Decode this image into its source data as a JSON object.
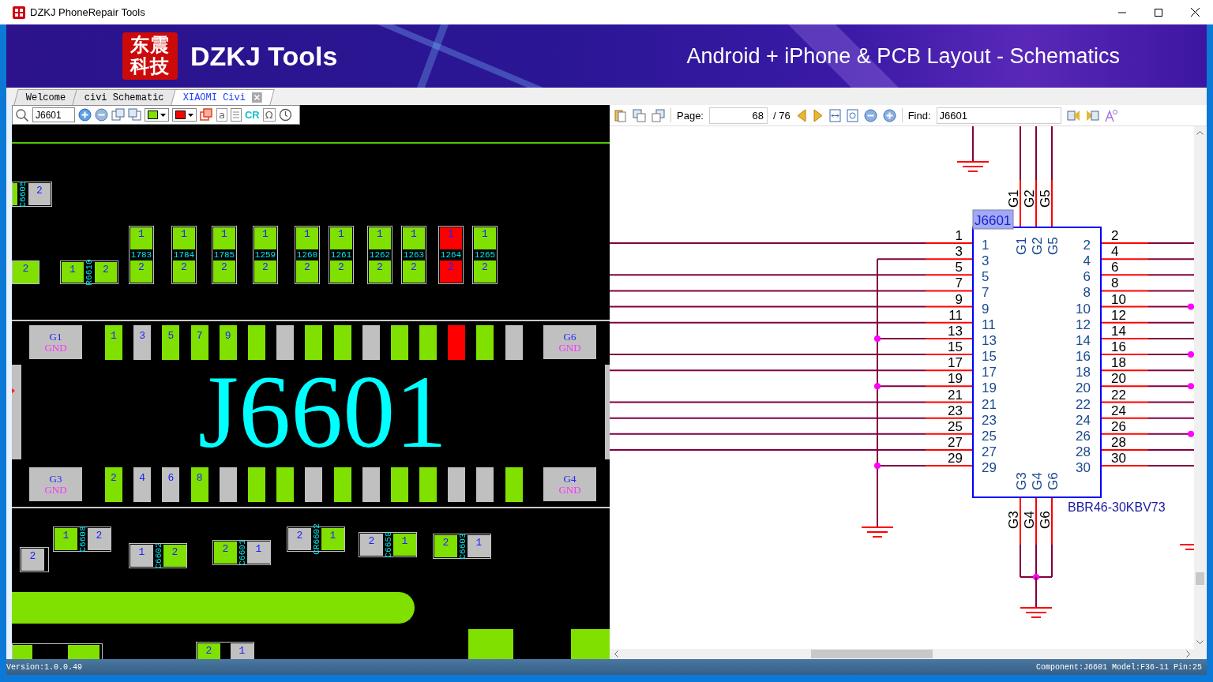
{
  "window": {
    "title": "DZKJ PhoneRepair Tools"
  },
  "banner": {
    "logo_lines": [
      "东震",
      "科技"
    ],
    "brand": "DZKJ Tools",
    "tagline": "Android + iPhone & PCB Layout - Schematics"
  },
  "tabs": [
    {
      "label": "Welcome",
      "selected": false,
      "closable": false
    },
    {
      "label": "civi Schematic",
      "selected": false,
      "closable": false
    },
    {
      "label": "XIAOMI Civi",
      "selected": true,
      "closable": true
    }
  ],
  "pcb_toolbar": {
    "search": "J6601",
    "color_pickers": [
      {
        "color": "#80e000"
      },
      {
        "color": "#ff0000"
      }
    ],
    "letter_button": "a",
    "cr_button": "CR",
    "omega_button": "Ω"
  },
  "pcb": {
    "corner_part": {
      "label": "C6605",
      "pad": "2"
    },
    "left_pads": [
      {
        "label": "2"
      }
    ],
    "resistor": {
      "label": "R6610",
      "pads": [
        "1",
        "2"
      ]
    },
    "vertical_parts": [
      {
        "label": "1783",
        "pad_1": "1",
        "pad_2": "2",
        "color": "#80e000"
      },
      {
        "label": "1784",
        "pad_1": "1",
        "pad_2": "2",
        "color": "#80e000"
      },
      {
        "label": "1785",
        "pad_1": "1",
        "pad_2": "2",
        "color": "#80e000"
      },
      {
        "label": "1259",
        "pad_1": "1",
        "pad_2": "2",
        "color": "#80e000"
      },
      {
        "label": "1260",
        "pad_1": "1",
        "pad_2": "2",
        "color": "#80e000"
      },
      {
        "label": "1261",
        "pad_1": "1",
        "pad_2": "2",
        "color": "#80e000"
      },
      {
        "label": "1262",
        "pad_1": "1",
        "pad_2": "2",
        "color": "#80e000"
      },
      {
        "label": "1263",
        "pad_1": "1",
        "pad_2": "2",
        "color": "#80e000"
      },
      {
        "label": "1264",
        "pad_1": "1",
        "pad_2": "2",
        "color": "#ff0000"
      },
      {
        "label": "1265",
        "pad_1": "1",
        "pad_2": "2",
        "color": "#80e000"
      }
    ],
    "connector": {
      "designator": "J6601",
      "ground_pads": [
        {
          "name": "G1",
          "net": "GND"
        },
        {
          "name": "G6",
          "net": "GND"
        },
        {
          "name": "G3",
          "net": "GND"
        },
        {
          "name": "G4",
          "net": "GND"
        }
      ],
      "top_pins": [
        {
          "label": "1",
          "color": "#80e000"
        },
        {
          "label": "3",
          "color": "#c0c0c0"
        },
        {
          "label": "5",
          "color": "#80e000"
        },
        {
          "label": "7",
          "color": "#80e000"
        },
        {
          "label": "9",
          "color": "#80e000"
        },
        {
          "color": "#80e000"
        },
        {
          "color": "#c0c0c0"
        },
        {
          "color": "#80e000"
        },
        {
          "color": "#80e000"
        },
        {
          "color": "#c0c0c0"
        },
        {
          "color": "#80e000"
        },
        {
          "color": "#80e000"
        },
        {
          "color": "#ff0000"
        },
        {
          "color": "#80e000"
        },
        {
          "color": "#c0c0c0"
        }
      ],
      "bottom_pins": [
        {
          "label": "2",
          "color": "#80e000"
        },
        {
          "label": "4",
          "color": "#c0c0c0"
        },
        {
          "label": "6",
          "color": "#c0c0c0"
        },
        {
          "label": "8",
          "color": "#80e000"
        },
        {
          "color": "#c0c0c0"
        },
        {
          "color": "#80e000"
        },
        {
          "color": "#80e000"
        },
        {
          "color": "#c0c0c0"
        },
        {
          "color": "#80e000"
        },
        {
          "color": "#c0c0c0"
        },
        {
          "color": "#80e000"
        },
        {
          "color": "#80e000"
        },
        {
          "color": "#c0c0c0"
        },
        {
          "color": "#c0c0c0"
        },
        {
          "color": "#80e000"
        }
      ]
    },
    "lower_parts": [
      {
        "pads": [
          {
            "label": "2",
            "color": "#c0c0c0"
          }
        ]
      },
      {
        "label": "C6608",
        "pads": [
          {
            "label": "1",
            "color": "#80e000"
          },
          {
            "label": "2",
            "color": "#c0c0c0"
          }
        ]
      },
      {
        "label": "C6602",
        "pads": [
          {
            "label": "1",
            "color": "#c0c0c0"
          },
          {
            "label": "2",
            "color": "#80e000"
          }
        ]
      },
      {
        "label": "C6601",
        "pads": [
          {
            "label": "2",
            "color": "#80e000"
          },
          {
            "label": "1",
            "color": "#c0c0c0"
          }
        ]
      },
      {
        "label": "CR6602",
        "pads": [
          {
            "label": "2",
            "color": "#c0c0c0"
          },
          {
            "label": "1",
            "color": "#80e000"
          }
        ]
      },
      {
        "label": "C6658",
        "pads": [
          {
            "label": "2",
            "color": "#c0c0c0"
          },
          {
            "label": "1",
            "color": "#80e000"
          }
        ]
      },
      {
        "label": "C6603",
        "pads": [
          {
            "label": "2",
            "color": "#80e000"
          },
          {
            "label": "1",
            "color": "#c0c0c0"
          }
        ]
      },
      {
        "pads": [
          {
            "label": "2",
            "color": "#80e000"
          },
          {
            "label": "1",
            "color": "#c0c0c0"
          }
        ]
      }
    ]
  },
  "viewer_toolbar": {
    "page_label": "Page:",
    "page": "68",
    "page_total": "/ 76",
    "find_label": "Find:",
    "find": "J6601"
  },
  "schematic": {
    "designator": "J6601",
    "part_number": "BBR46-30KBV73",
    "top_pins": [
      {
        "number": "G1",
        "name": "G1"
      },
      {
        "number": "G2",
        "name": "G2"
      },
      {
        "number": "G5",
        "name": "G5"
      }
    ],
    "bottom_pins": [
      {
        "number": "G3",
        "name": "G3"
      },
      {
        "number": "G4",
        "name": "G4"
      },
      {
        "number": "G6",
        "name": "G6"
      }
    ],
    "left_pins": [
      {
        "number": "1",
        "name": "1",
        "kind": "wire",
        "junction": false
      },
      {
        "number": "3",
        "name": "3",
        "kind": "bus",
        "junction": false
      },
      {
        "number": "5",
        "name": "5",
        "kind": "wire",
        "junction": false
      },
      {
        "number": "7",
        "name": "7",
        "kind": "wire",
        "junction": false
      },
      {
        "number": "9",
        "name": "9",
        "kind": "wire",
        "junction": false
      },
      {
        "number": "11",
        "name": "11",
        "kind": "wire",
        "junction": false
      },
      {
        "number": "13",
        "name": "13",
        "kind": "bus",
        "junction": true
      },
      {
        "number": "15",
        "name": "15",
        "kind": "wire",
        "junction": false
      },
      {
        "number": "17",
        "name": "17",
        "kind": "wire",
        "junction": false
      },
      {
        "number": "19",
        "name": "19",
        "kind": "bus",
        "junction": true
      },
      {
        "number": "21",
        "name": "21",
        "kind": "wire",
        "junction": false
      },
      {
        "number": "23",
        "name": "23",
        "kind": "wire",
        "junction": false
      },
      {
        "number": "25",
        "name": "25",
        "kind": "wire",
        "junction": false
      },
      {
        "number": "27",
        "name": "27",
        "kind": "wire",
        "junction": false
      },
      {
        "number": "29",
        "name": "29",
        "kind": "bus",
        "junction": true
      }
    ],
    "right_pins": [
      {
        "number": "2",
        "name": "2",
        "junction": false
      },
      {
        "number": "4",
        "name": "4",
        "junction": false
      },
      {
        "number": "6",
        "name": "6",
        "junction": false
      },
      {
        "number": "8",
        "name": "8",
        "junction": false
      },
      {
        "number": "10",
        "name": "10",
        "junction": true
      },
      {
        "number": "12",
        "name": "12",
        "junction": false
      },
      {
        "number": "14",
        "name": "14",
        "junction": false
      },
      {
        "number": "16",
        "name": "16",
        "junction": true
      },
      {
        "number": "18",
        "name": "18",
        "junction": false
      },
      {
        "number": "20",
        "name": "20",
        "junction": true
      },
      {
        "number": "22",
        "name": "22",
        "junction": false
      },
      {
        "number": "24",
        "name": "24",
        "junction": false
      },
      {
        "number": "26",
        "name": "26",
        "junction": true
      },
      {
        "number": "28",
        "name": "28",
        "junction": false
      },
      {
        "number": "30",
        "name": "30",
        "junction": false
      }
    ]
  },
  "status_bar": {
    "version": "Version:1.0.0.49",
    "component_info": "Component:J6601 Model:F36-11 Pin:25"
  }
}
